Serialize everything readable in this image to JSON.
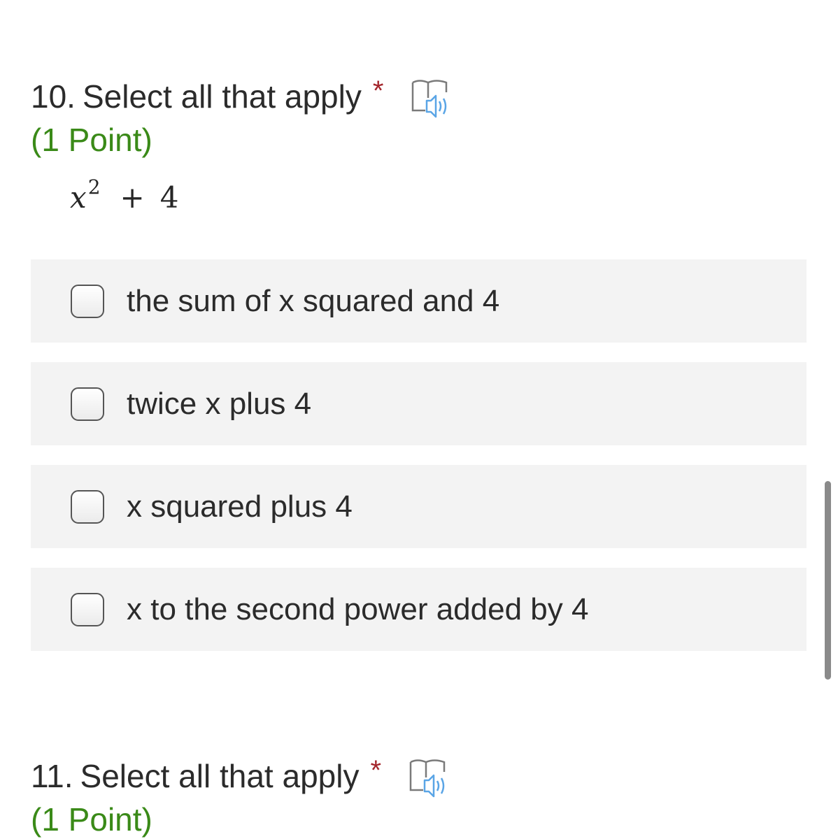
{
  "questions": [
    {
      "number": "10.",
      "title": "Select all that apply",
      "required_marker": "*",
      "points": "(1 Point)",
      "reader_icon": "immersive-reader-icon",
      "expression": {
        "variable": "x",
        "exponent": "2",
        "operator": "+",
        "constant": "4"
      },
      "options": [
        {
          "label": "the sum of x squared and 4",
          "checked": false
        },
        {
          "label": "twice x plus 4",
          "checked": false
        },
        {
          "label": "x squared plus 4",
          "checked": false
        },
        {
          "label": "x to the second power added by 4",
          "checked": false
        }
      ]
    },
    {
      "number": "11.",
      "title": "Select all that apply",
      "required_marker": "*",
      "points": "(1 Point)",
      "reader_icon": "immersive-reader-icon"
    }
  ],
  "colors": {
    "required": "#a4262c",
    "points": "#3a8a18",
    "option_background": "#f3f3f3",
    "reader_icon": "#5aa5e6"
  }
}
